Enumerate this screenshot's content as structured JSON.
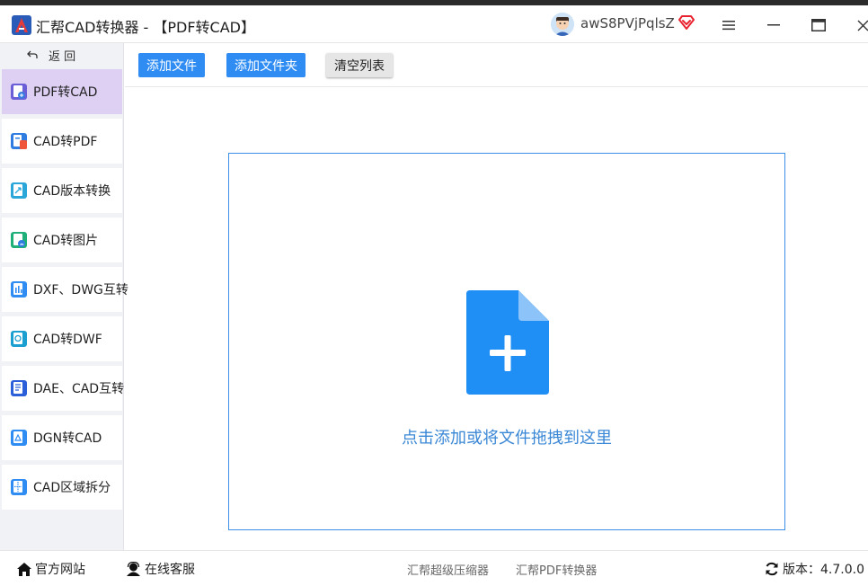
{
  "window": {
    "title": "汇帮CAD转换器 - 【PDF转CAD】",
    "username": "awS8PVjPqlsZ"
  },
  "sidebar": {
    "back_label": "返 回",
    "items": [
      {
        "label": "PDF转CAD",
        "active": true
      },
      {
        "label": "CAD转PDF"
      },
      {
        "label": "CAD版本转换"
      },
      {
        "label": "CAD转图片"
      },
      {
        "label": "DXF、DWG互转"
      },
      {
        "label": "CAD转DWF"
      },
      {
        "label": "DAE、CAD互转"
      },
      {
        "label": "DGN转CAD"
      },
      {
        "label": "CAD区域拆分"
      }
    ]
  },
  "toolbar": {
    "add_file_label": "添加文件",
    "add_folder_label": "添加文件夹",
    "clear_list_label": "清空列表"
  },
  "dropzone": {
    "hint": "点击添加或将文件拖拽到这里"
  },
  "footer": {
    "website_label": "官方网站",
    "support_label": "在线客服",
    "link1_label": "汇帮超级压缩器",
    "link2_label": "汇帮PDF转换器",
    "version_label": "版本：4.7.0.0"
  },
  "colors": {
    "accent": "#2f8cf3",
    "active_nav": "#ddd0f3",
    "drop_border": "#3d8ee6",
    "drop_text": "#3a87d6"
  }
}
